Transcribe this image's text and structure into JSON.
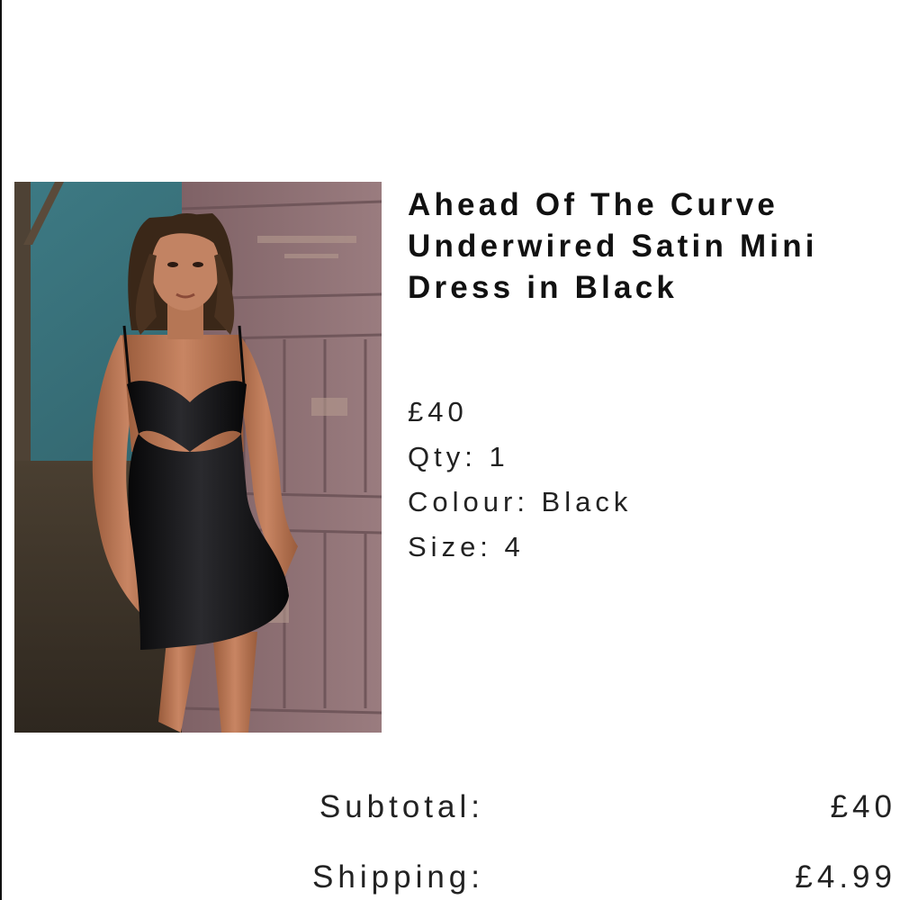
{
  "product": {
    "image_alt": "Model wearing black underwired satin mini dress",
    "title": "Ahead Of The Curve Underwired Satin Mini Dress in Black",
    "price": "£40",
    "qty": "Qty: 1",
    "colour": "Colour: Black",
    "size": "Size: 4"
  },
  "totals": {
    "subtotal_label": "Subtotal:",
    "subtotal_value": "£40",
    "shipping_label": "Shipping:",
    "shipping_value": "£4.99"
  },
  "colors": {
    "background": "#ffffff",
    "text": "#1a1a1a",
    "door": "#8e6f72",
    "wall": "#3f7780",
    "dress": "#0d0d0f"
  }
}
